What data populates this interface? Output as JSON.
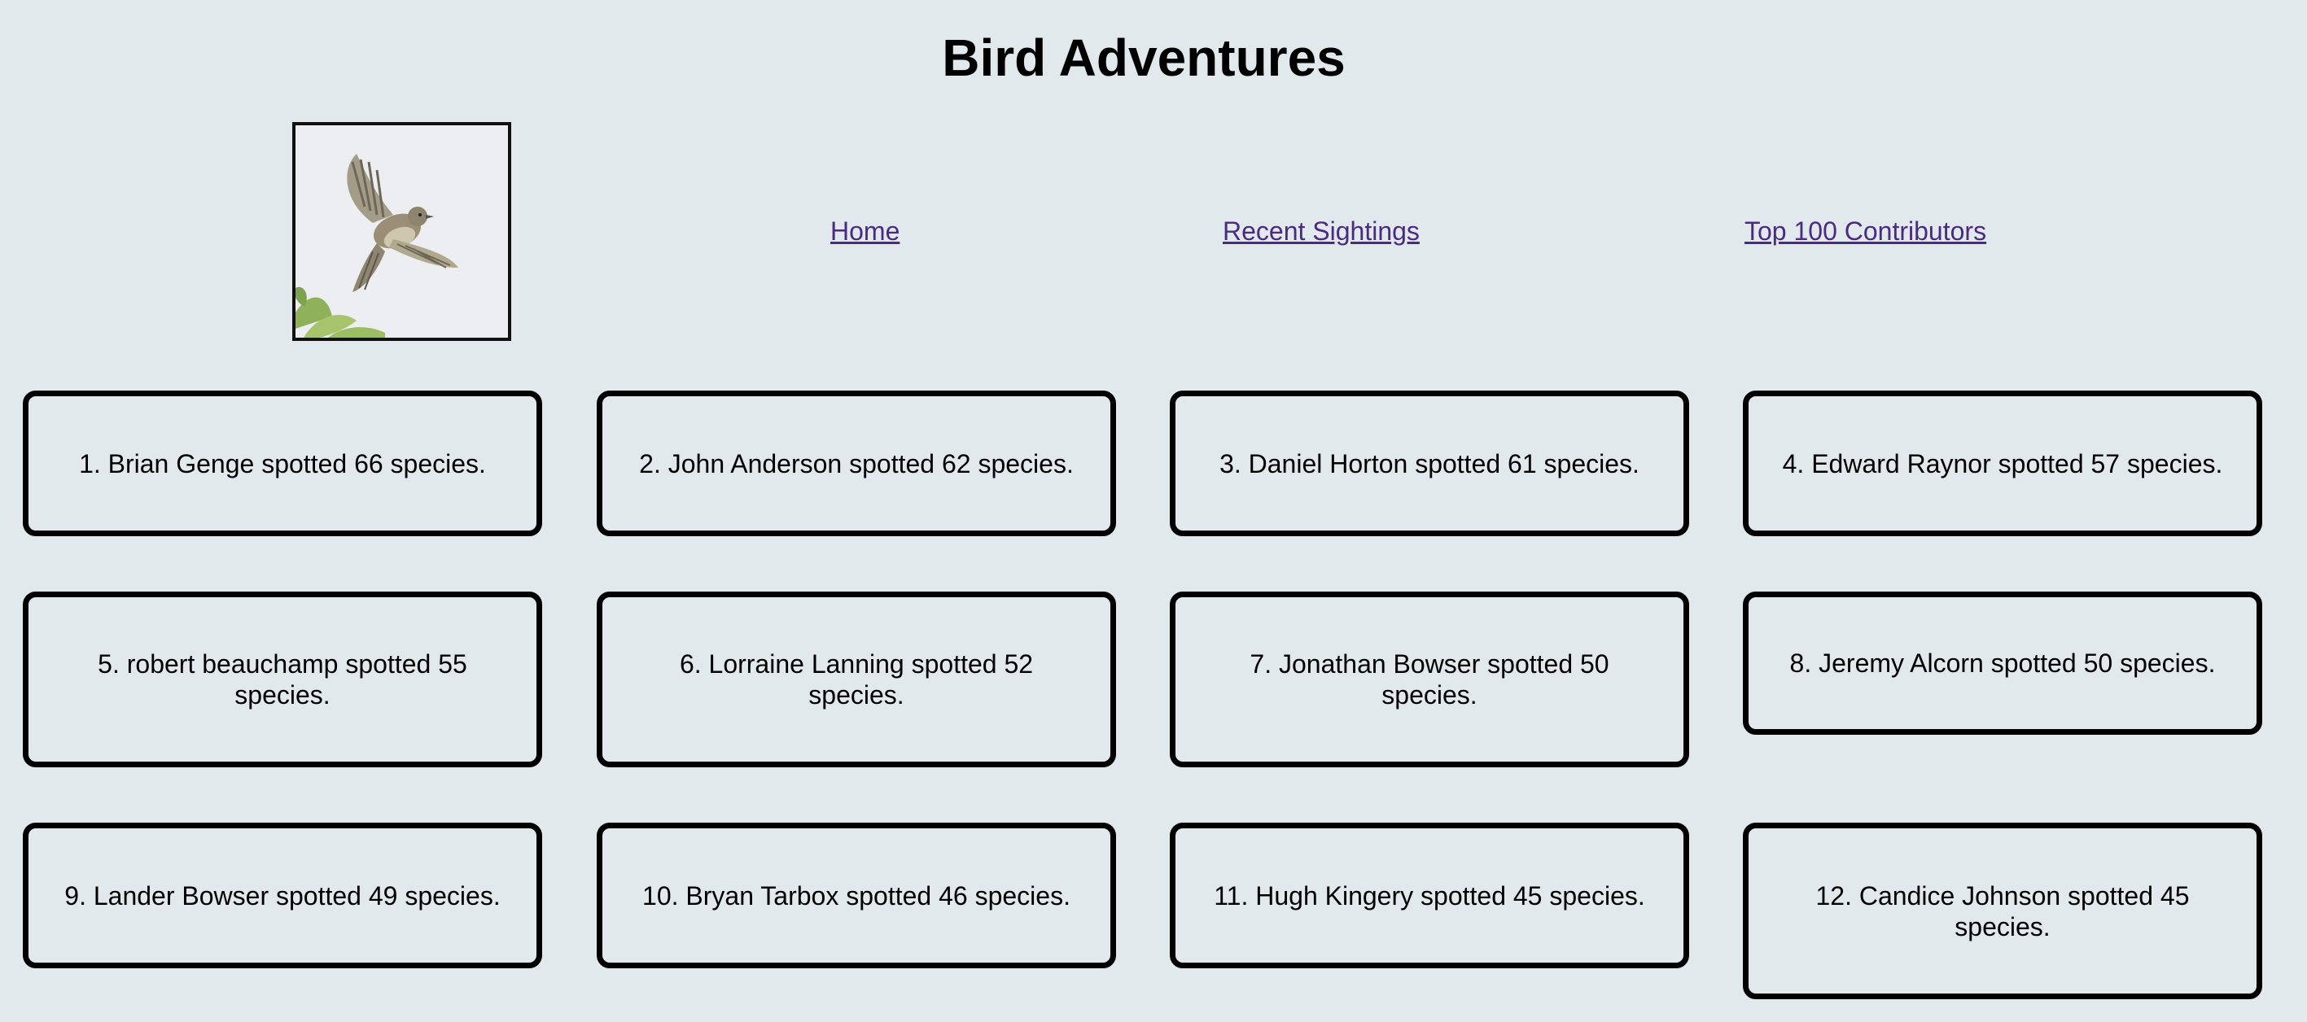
{
  "header": {
    "title": "Bird Adventures"
  },
  "nav": {
    "home": "Home",
    "recent": "Recent Sightings",
    "top100": "Top 100 Contributors"
  },
  "logo": {
    "icon": "flying-bird-photo"
  },
  "contributors": [
    "1. Brian Genge spotted 66 species.",
    "2. John Anderson spotted 62 species.",
    "3. Daniel Horton spotted 61 species.",
    "4. Edward Raynor spotted 57 species.",
    "5. robert beauchamp spotted 55 species.",
    "6. Lorraine Lanning spotted 52 species.",
    "7. Jonathan Bowser spotted 50 species.",
    "8. Jeremy Alcorn spotted 50 species.",
    "9. Lander Bowser spotted 49 species.",
    "10. Bryan Tarbox spotted 46 species.",
    "11. Hugh Kingery spotted 45 species.",
    "12. Candice Johnson spotted 45 species."
  ],
  "colors": {
    "background": "#e2e9ed",
    "link": "#4b2a82",
    "border": "#000000"
  }
}
